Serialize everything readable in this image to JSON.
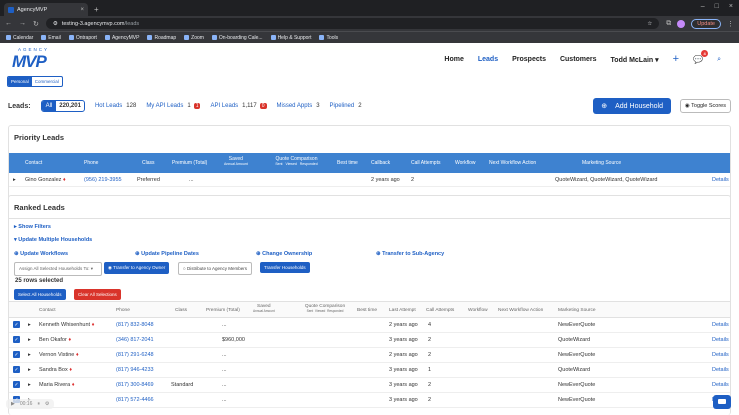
{
  "browser": {
    "tab_title": "AgencyMVP",
    "url_host": "testing-3.agencymvp.com",
    "url_path": "/leads",
    "update_label": "Update",
    "bookmarks": [
      "Calendar",
      "Email",
      "Ontraport",
      "AgencyMVP",
      "Roadmap",
      "Zoom",
      "On-boarding Cale...",
      "Help & Support",
      "Tools"
    ]
  },
  "nav": {
    "logo_top": "AGENCY",
    "logo_main": "MVP",
    "items": [
      "Home",
      "Leads",
      "Prospects",
      "Customers"
    ],
    "active": "Leads",
    "user": "Todd McLain",
    "chat_badge": "4"
  },
  "mode_toggle": {
    "personal": "Personal",
    "commercial": "Commercial"
  },
  "leads_bar": {
    "label": "Leads:",
    "all_label": "All",
    "all_count": "220,201",
    "filters": [
      {
        "label": "Hot Leads",
        "count": "128"
      },
      {
        "label": "My API Leads",
        "count": "1",
        "badge": "1"
      },
      {
        "label": "API Leads",
        "count": "1,117",
        "badge": "0"
      },
      {
        "label": "Missed Appts",
        "count": "3"
      },
      {
        "label": "Pipelined",
        "count": "2"
      }
    ],
    "add_household": "Add Household",
    "toggle_scores": "Toggle Scores"
  },
  "priority": {
    "title": "Priority Leads",
    "headers": {
      "contact": "Contact",
      "phone": "Phone",
      "class": "Class",
      "premium": "Premium (Total)",
      "saved": "Saved",
      "saved_sub": "Annual Amount",
      "quote": "Quote Comparison",
      "sent": "Sent",
      "viewed": "Viewed",
      "responded": "Responded",
      "best_time": "Best time",
      "callback": "Callback",
      "attempts": "Call Attempts",
      "workflow": "Workflow",
      "next_action": "Next Workflow Action",
      "source": "Marketing Source"
    },
    "rows": [
      {
        "contact": "Gino Gonzalez",
        "phone": "(956) 219-3955",
        "class": "Preferred",
        "premium": "...",
        "callback": "2 years ago",
        "attempts": "2",
        "source": "QuoteWizard, QuoteWizard, QuoteWizard",
        "details": "Details"
      }
    ]
  },
  "ranked": {
    "title": "Ranked Leads",
    "show_filters": "Show Filters",
    "update_multiple": "Update Multiple Households",
    "update_workflows": "Update Workflows",
    "update_pipeline": "Update Pipeline Dates",
    "change_ownership": "Change Ownership",
    "transfer_sub": "Transfer to Sub-Agency",
    "assign_placeholder": "Assign All Selected Households To:",
    "transfer_owner": "Transfer to Agency Owner",
    "distribute": "Distribute to Agency Members",
    "transfer_households": "Transfer Households",
    "rows_selected": "25 rows selected",
    "select_all": "Select All Households",
    "clear_all": "Clear All Selections",
    "headers": {
      "contact": "Contact",
      "phone": "Phone",
      "class": "Class",
      "premium": "Premium (Total)",
      "saved": "Saved",
      "saved_sub": "Annual Amount",
      "quote": "Quote Comparison",
      "sent": "Sent",
      "viewed": "Viewed",
      "responded": "Responded",
      "best_time": "Best time",
      "last_attempt": "Last Attempt",
      "attempts": "Call Attempts",
      "workflow": "Workflow",
      "next_action": "Next Workflow Action",
      "source": "Marketing Source"
    },
    "rows": [
      {
        "contact": "Kenneth Whisenhunt",
        "phone": "(817) 832-8048",
        "class": "",
        "premium": "...",
        "last": "2 years ago",
        "attempts": "4",
        "source": "NewEverQuote",
        "details": "Details"
      },
      {
        "contact": "Ben Okafor",
        "phone": "(346) 817-2041",
        "class": "",
        "premium": "$960,000",
        "last": "3 years ago",
        "attempts": "2",
        "source": "QuoteWizard",
        "details": "Details"
      },
      {
        "contact": "Vernon Vistine",
        "phone": "(817) 291-6248",
        "class": "",
        "premium": "...",
        "last": "2 years ago",
        "attempts": "2",
        "source": "NewEverQuote",
        "details": "Details"
      },
      {
        "contact": "Sandra Box",
        "phone": "(817) 946-4233",
        "class": "",
        "premium": "...",
        "last": "3 years ago",
        "attempts": "1",
        "source": "QuoteWizard",
        "details": "Details"
      },
      {
        "contact": "Maria Rivera",
        "phone": "(817) 300-8469",
        "class": "Standard",
        "premium": "...",
        "last": "3 years ago",
        "attempts": "2",
        "source": "NewEverQuote",
        "details": "Details"
      },
      {
        "contact": "",
        "phone": "(817) 572-4466",
        "class": "",
        "premium": "...",
        "last": "3 years ago",
        "attempts": "2",
        "source": "NewEverQuote",
        "details": "Details"
      }
    ]
  },
  "player": {
    "time": "00:16"
  }
}
